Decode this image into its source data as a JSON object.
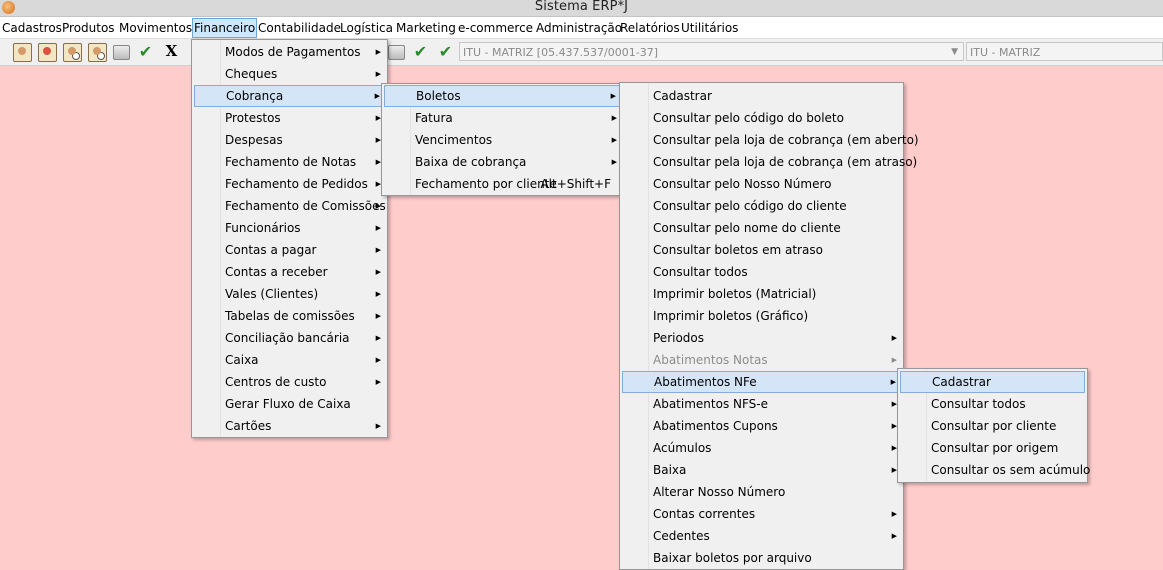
{
  "window": {
    "title": "Sistema ERP*J",
    "app_icon": "app-logo-icon"
  },
  "menubar": {
    "items": [
      {
        "label": "Cadastros"
      },
      {
        "label": "Produtos"
      },
      {
        "label": "Movimentos"
      },
      {
        "label": "Financeiro"
      },
      {
        "label": "Contabilidade"
      },
      {
        "label": "Logística"
      },
      {
        "label": "Marketing"
      },
      {
        "label": "e-commerce"
      },
      {
        "label": "Administração"
      },
      {
        "label": "Relatórios"
      },
      {
        "label": "Utilitários"
      }
    ],
    "active": "Financeiro"
  },
  "toolbar": {
    "buttons": [
      "person-icon",
      "person-red-icon",
      "person-search-icon",
      "person-search-icon",
      "printer-icon",
      "check-icon",
      "close-x-icon"
    ],
    "x_label": "X",
    "check_glyph": "✔",
    "company_select": "ITU - MATRIZ [05.437.537/0001-37]",
    "branch_select": "ITU - MATRIZ",
    "dropdown_glyph": "▼"
  },
  "menus": {
    "financeiro": [
      {
        "label": "Modos de Pagamentos",
        "submenu": true
      },
      {
        "label": "Cheques",
        "submenu": true
      },
      {
        "label": "Cobrança",
        "submenu": true,
        "highlighted": true
      },
      {
        "label": "Protestos",
        "submenu": true
      },
      {
        "label": "Despesas",
        "submenu": true
      },
      {
        "label": "Fechamento de Notas",
        "submenu": true
      },
      {
        "label": "Fechamento de Pedidos",
        "submenu": true
      },
      {
        "label": "Fechamento de Comissões",
        "submenu": true
      },
      {
        "label": "Funcionários",
        "submenu": true
      },
      {
        "label": "Contas a pagar",
        "submenu": true
      },
      {
        "label": "Contas a receber",
        "submenu": true
      },
      {
        "label": "Vales (Clientes)",
        "submenu": true
      },
      {
        "label": "Tabelas de comissões",
        "submenu": true
      },
      {
        "label": "Conciliação bancária",
        "submenu": true
      },
      {
        "label": "Caixa",
        "submenu": true
      },
      {
        "label": "Centros de custo",
        "submenu": true
      },
      {
        "label": "Gerar Fluxo de Caixa",
        "submenu": false
      },
      {
        "label": "Cartões",
        "submenu": true
      }
    ],
    "cobranca": [
      {
        "label": "Boletos",
        "submenu": true,
        "highlighted": true
      },
      {
        "label": "Fatura",
        "submenu": true
      },
      {
        "label": "Vencimentos",
        "submenu": true
      },
      {
        "label": "Baixa de cobrança",
        "submenu": true
      },
      {
        "label": "Fechamento por cliente",
        "shortcut": "Alt+Shift+F"
      }
    ],
    "boletos": [
      {
        "label": "Cadastrar"
      },
      {
        "label": "Consultar pelo código do boleto"
      },
      {
        "label": "Consultar pela loja de cobrança (em aberto)"
      },
      {
        "label": "Consultar pela loja de cobrança (em atraso)"
      },
      {
        "label": "Consultar pelo Nosso Número"
      },
      {
        "label": "Consultar pelo código do cliente"
      },
      {
        "label": "Consultar pelo nome do cliente"
      },
      {
        "label": "Consultar boletos em atraso"
      },
      {
        "label": "Consultar todos"
      },
      {
        "label": "Imprimir boletos (Matricial)"
      },
      {
        "label": "Imprimir boletos (Gráfico)"
      },
      {
        "label": "Periodos",
        "submenu": true
      },
      {
        "label": "Abatimentos Notas",
        "submenu": true,
        "disabled": true
      },
      {
        "label": "Abatimentos NFe",
        "submenu": true,
        "highlighted": true
      },
      {
        "label": "Abatimentos NFS-e",
        "submenu": true
      },
      {
        "label": "Abatimentos Cupons",
        "submenu": true
      },
      {
        "label": "Acúmulos",
        "submenu": true
      },
      {
        "label": "Baixa",
        "submenu": true
      },
      {
        "label": "Alterar Nosso Número"
      },
      {
        "label": "Contas correntes",
        "submenu": true
      },
      {
        "label": "Cedentes",
        "submenu": true
      },
      {
        "label": "Baixar boletos por arquivo"
      }
    ],
    "abatimentos_nfe": [
      {
        "label": "Cadastrar",
        "highlighted": true
      },
      {
        "label": "Consultar todos"
      },
      {
        "label": "Consultar por cliente"
      },
      {
        "label": "Consultar por origem"
      },
      {
        "label": "Consultar os sem acúmulo"
      }
    ],
    "submenu_arrow": "▶"
  },
  "colors": {
    "desktop_background": "#ffcccc",
    "menu_highlight": "#d4e5f7",
    "menubar_active": "#cce8ff"
  }
}
